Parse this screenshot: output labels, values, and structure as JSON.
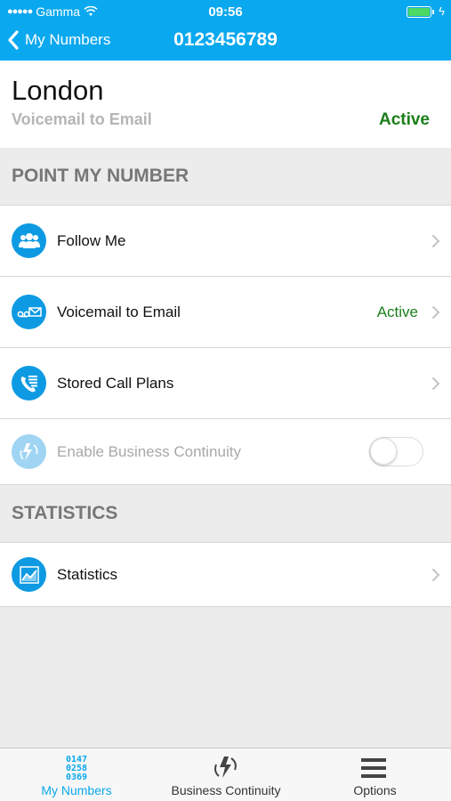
{
  "status_bar": {
    "signal_dots": "●●●●●",
    "carrier": "Gamma",
    "time": "09:56"
  },
  "nav": {
    "back_label": "My Numbers",
    "title": "0123456789"
  },
  "header": {
    "city": "London",
    "service": "Voicemail to Email",
    "status": "Active"
  },
  "sections": {
    "point_my_number": "POINT MY NUMBER",
    "statistics": "STATISTICS"
  },
  "rows": [
    {
      "label": "Follow Me",
      "value": "",
      "icon": "people-icon"
    },
    {
      "label": "Voicemail to Email",
      "value": "Active",
      "icon": "voicemail-email-icon"
    },
    {
      "label": "Stored Call Plans",
      "value": "",
      "icon": "call-plans-icon"
    },
    {
      "label": "Enable Business Continuity",
      "icon": "business-continuity-icon",
      "toggle_on": false
    },
    {
      "label": "Statistics",
      "value": "",
      "icon": "chart-icon"
    }
  ],
  "tabbar": {
    "tabs": [
      {
        "label": "My  Numbers",
        "digits": [
          "0147",
          "0258",
          "0369"
        ],
        "active": true
      },
      {
        "label": "Business  Continuity",
        "active": false
      },
      {
        "label": "Options",
        "active": false
      }
    ]
  },
  "colors": {
    "brand": "#0aa8ee",
    "active_green": "#1a7e1a",
    "icon_blue": "#0d9ae2"
  }
}
